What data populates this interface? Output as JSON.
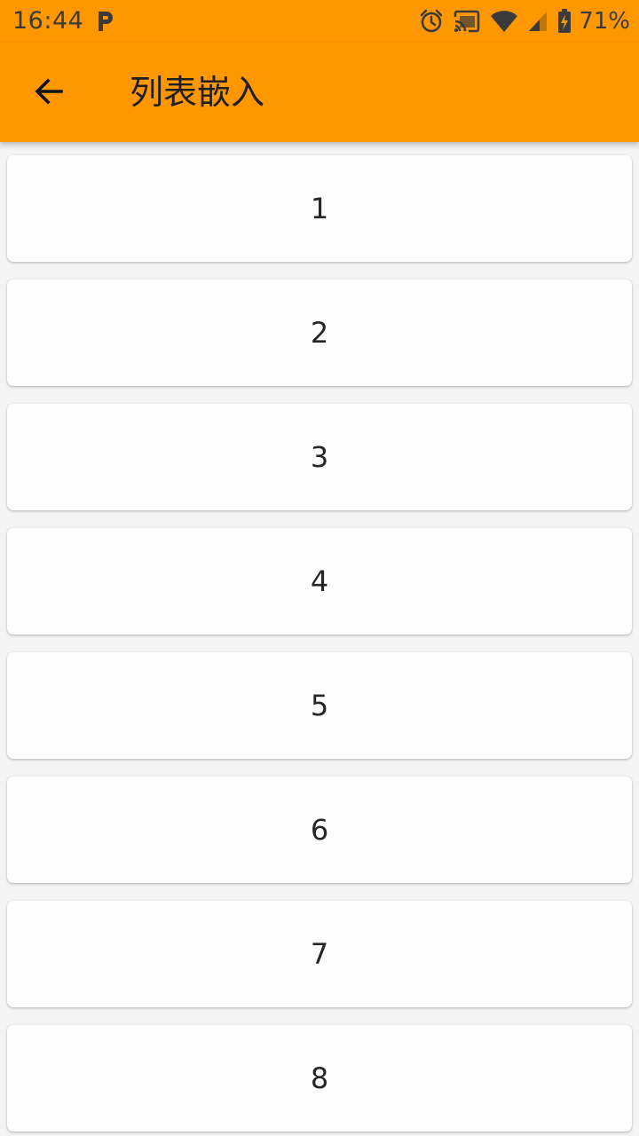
{
  "status_bar": {
    "time": "16:44",
    "battery_percent": "71%",
    "icons": [
      "p-notification-icon",
      "alarm-icon",
      "cast-icon",
      "wifi-icon",
      "signal-icon",
      "battery-charging-icon"
    ]
  },
  "app_bar": {
    "title": "列表嵌入",
    "back_icon": "arrow-back-icon"
  },
  "list": {
    "items": [
      {
        "label": "1"
      },
      {
        "label": "2"
      },
      {
        "label": "3"
      },
      {
        "label": "4"
      },
      {
        "label": "5"
      },
      {
        "label": "6"
      },
      {
        "label": "7"
      },
      {
        "label": "8"
      }
    ]
  },
  "colors": {
    "app_bar": "#ff9800",
    "background": "#f4f4f4",
    "card": "#fdfdfd",
    "text": "#262626"
  }
}
